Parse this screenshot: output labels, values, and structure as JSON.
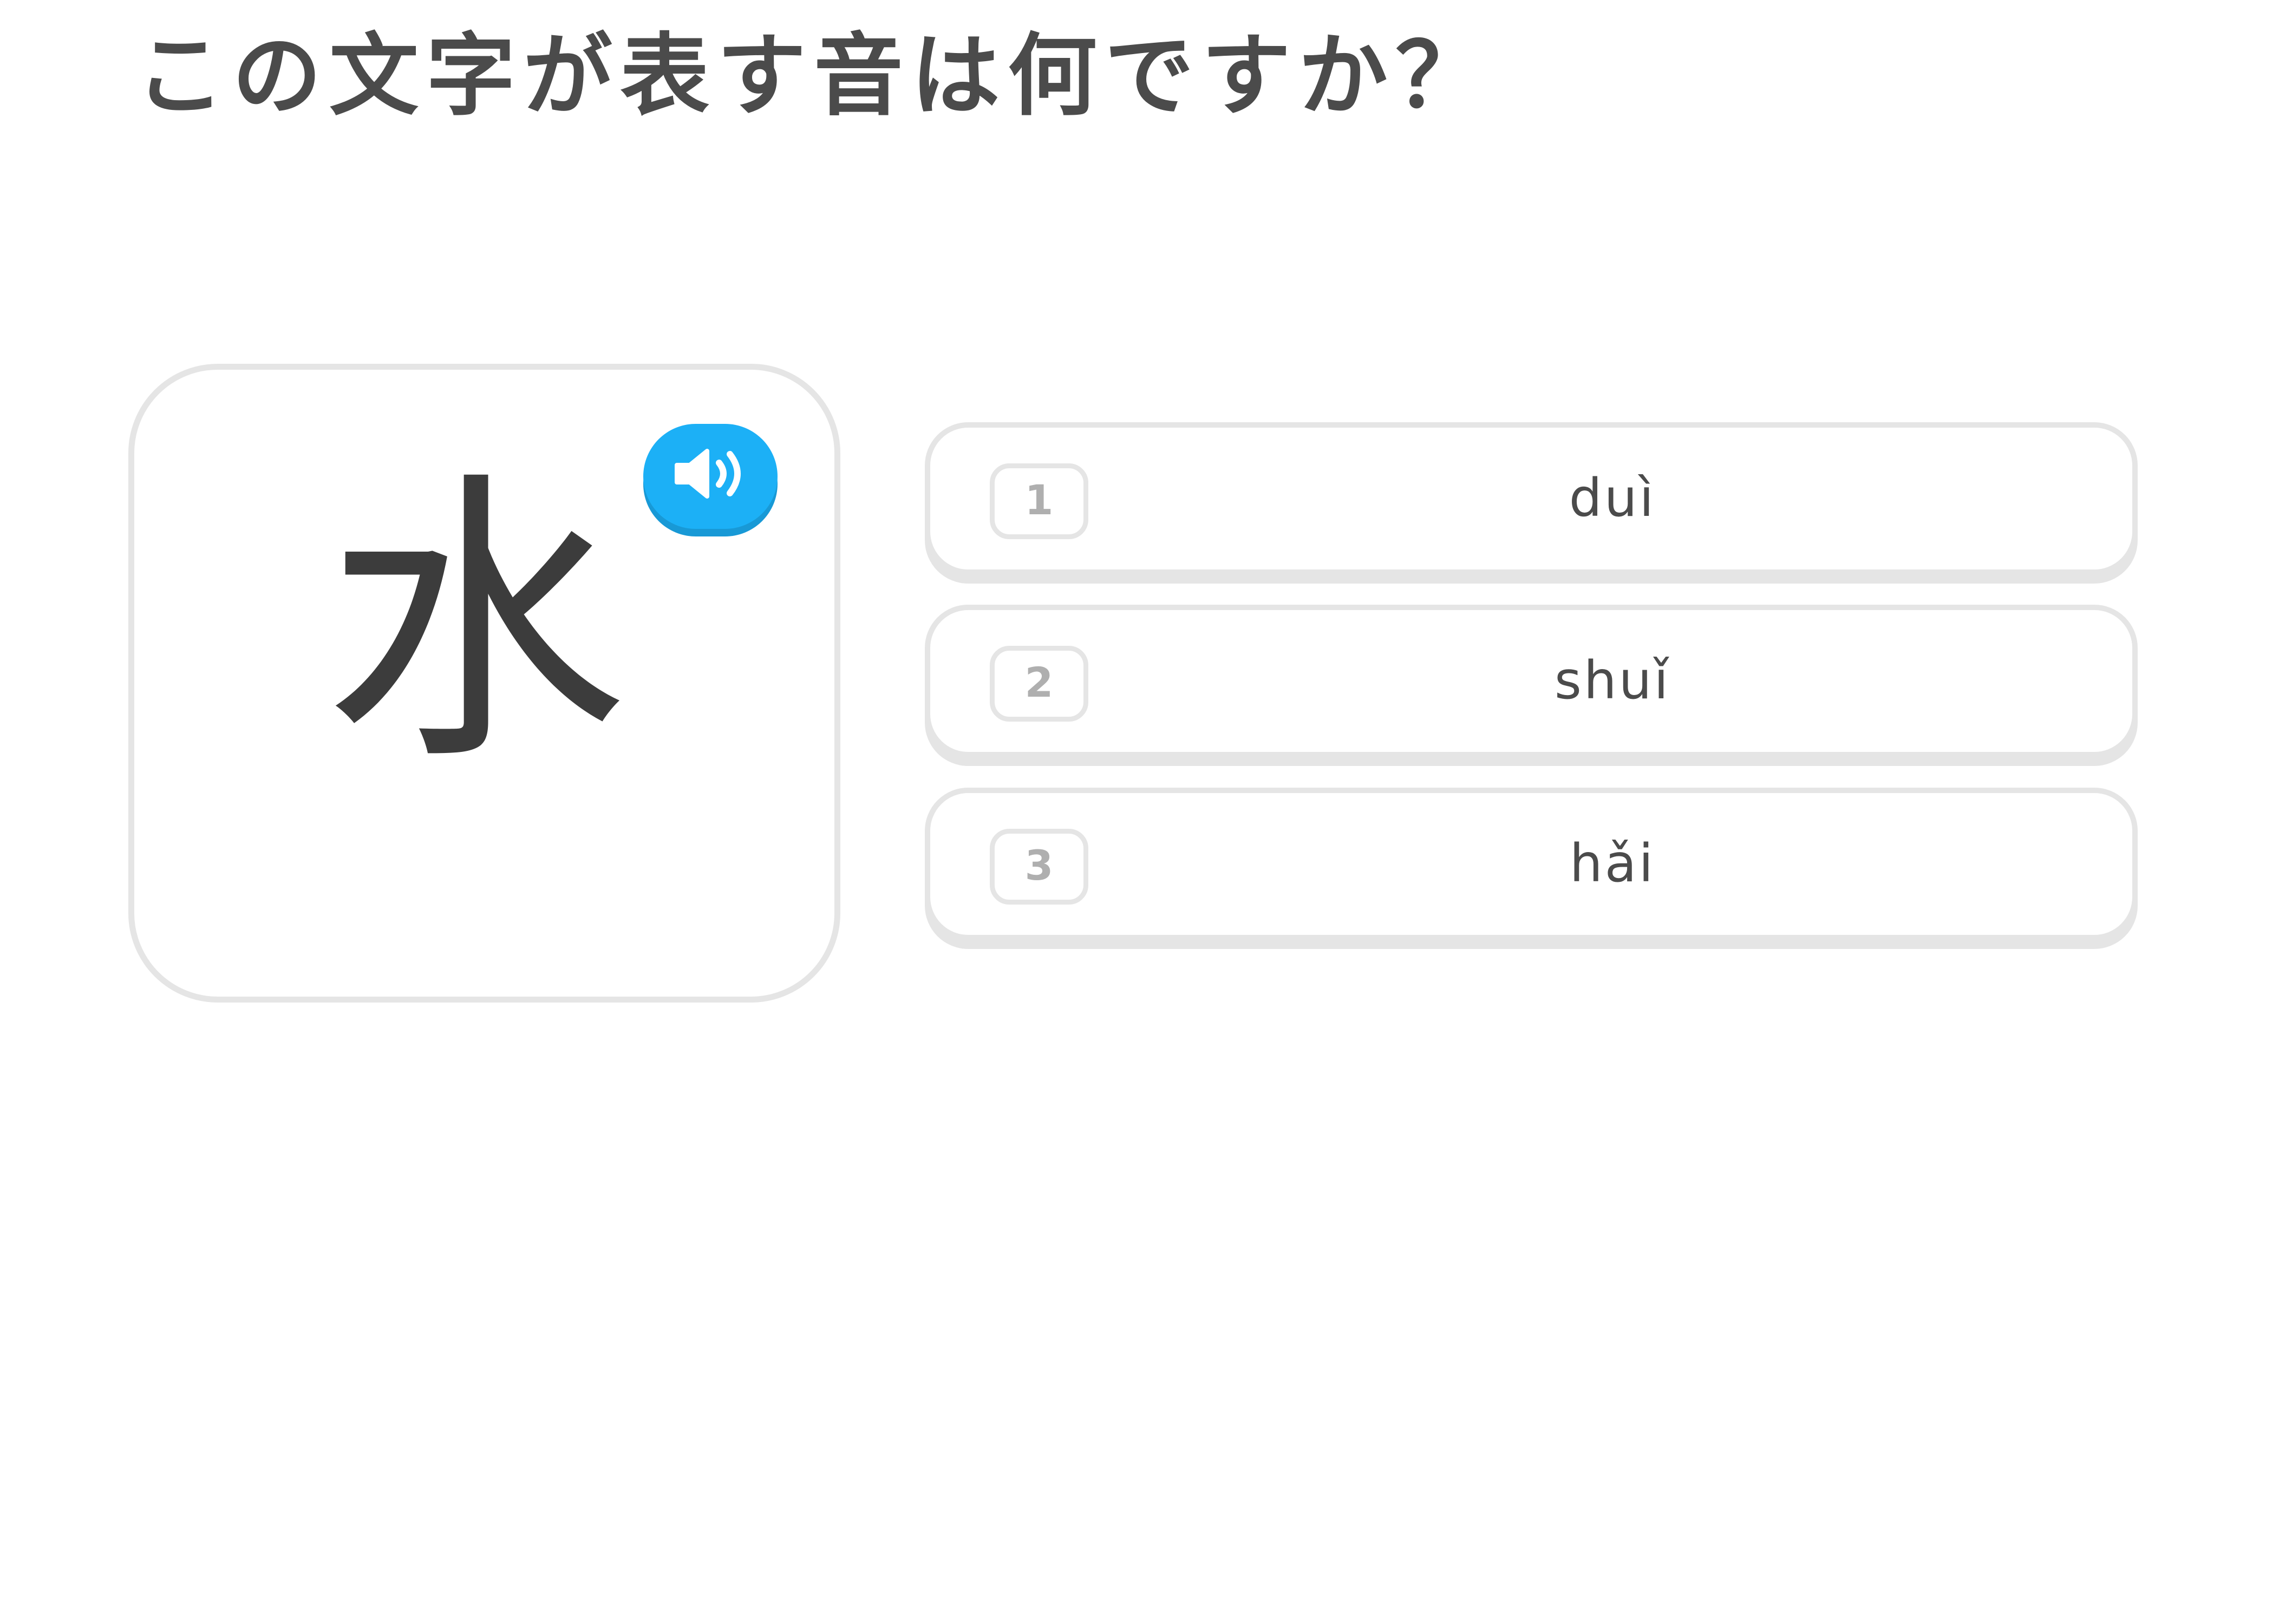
{
  "challenge": {
    "prompt": "この文字が表す音は何ですか？"
  },
  "character_card": {
    "character": "水",
    "speaker_icon": "speaker-icon",
    "accent_color": "#1cb0f6"
  },
  "choices": [
    {
      "number": "1",
      "label": "duì"
    },
    {
      "number": "2",
      "label": "shuǐ"
    },
    {
      "number": "3",
      "label": "hǎi"
    }
  ],
  "colors": {
    "border": "#e5e5e5",
    "text": "#4b4b4b",
    "number": "#afafaf"
  }
}
